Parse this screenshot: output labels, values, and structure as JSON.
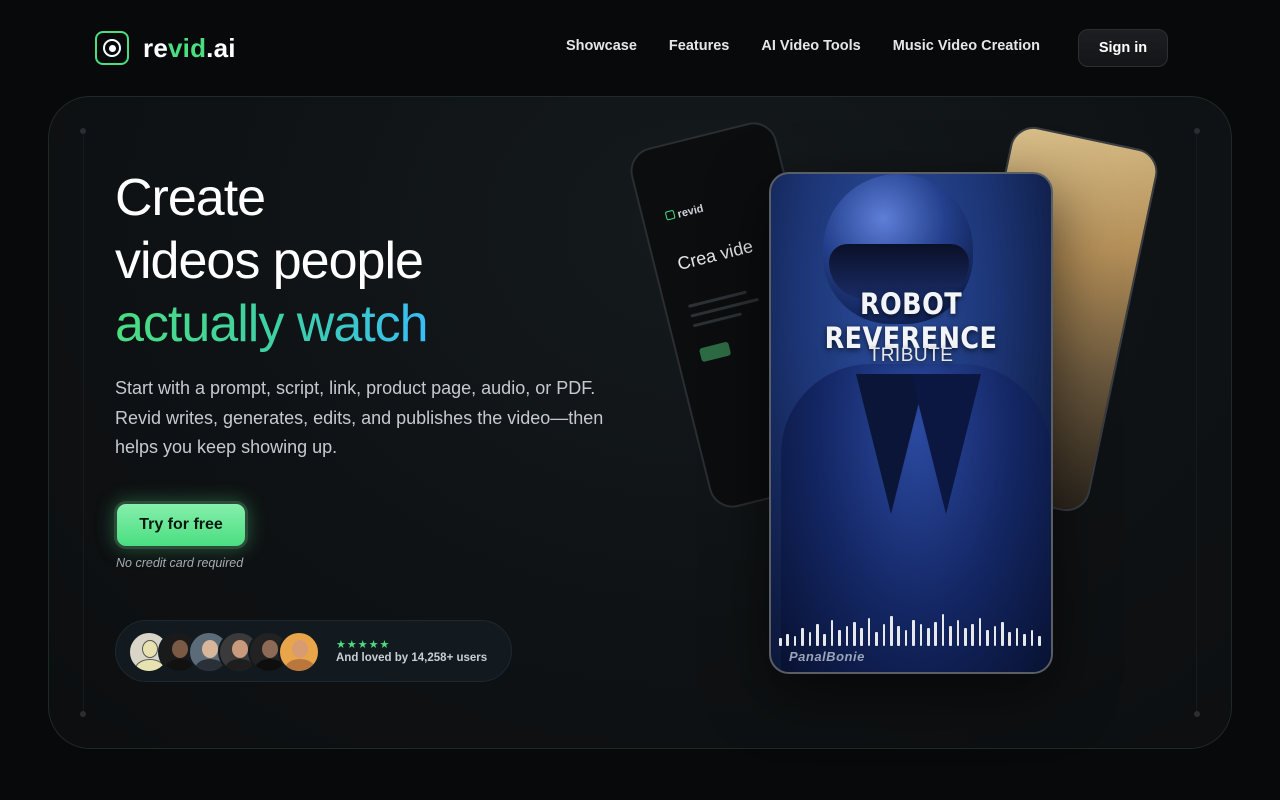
{
  "brand": {
    "name_main": "re",
    "name_accent": "vid",
    "name_tld": ".ai",
    "accent_color": "#4ade80"
  },
  "nav": {
    "links": [
      "Showcase",
      "Features",
      "AI Video Tools",
      "Music Video Creation"
    ],
    "signin_label": "Sign in"
  },
  "hero": {
    "title_line1": "Create",
    "title_line2": "videos people",
    "title_line3": "actually watch",
    "subtitle": "Start with a prompt, script, link, product page, audio, or PDF. Revid writes, generates, edits, and publishes the video—then helps you keep showing up.",
    "cta_label": "Try for free",
    "cta_note": "No credit card required"
  },
  "social_proof": {
    "stars": "★★★★★",
    "text": "And loved by 14,258+ users"
  },
  "preview": {
    "video_title": "ROBOT REVERENCE",
    "video_subtitle": "TRIBUTE",
    "watermark": "PanalBonie",
    "back_card_brand": "revid",
    "back_card_heading": "Crea vide"
  }
}
